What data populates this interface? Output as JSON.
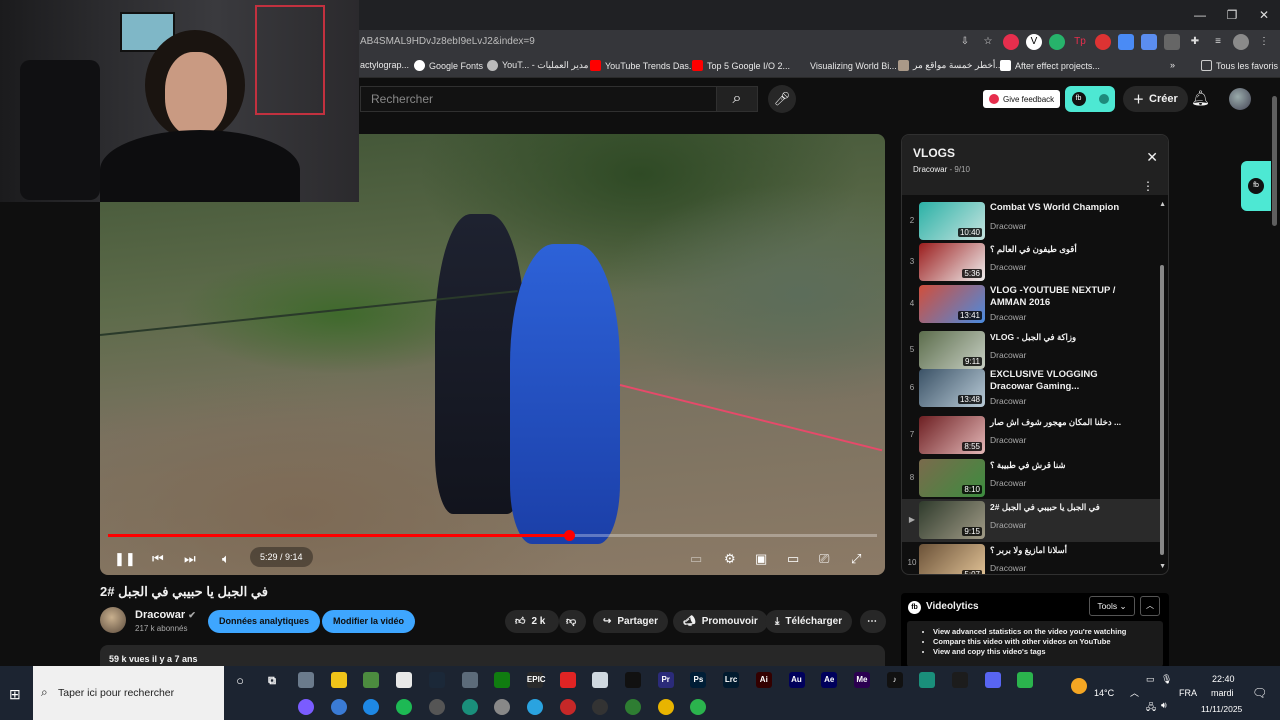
{
  "browser": {
    "url": "AB4SMAL9HDvJz8ebI9eLvJ2&index=9",
    "bookmarks": [
      "actylograp...",
      "Google Fonts",
      "YouT... - مدير العمليات",
      "YouTube Trends Das...",
      "Top 5 Google I/O 2...",
      "Visualizing World Bi...",
      "أخطر خمسة مواقع مر...",
      "After effect projects...",
      "»",
      "Tous les favoris"
    ]
  },
  "header": {
    "search_placeholder": "Rechercher",
    "feedback_label": "Give feedback",
    "create_label": "Créer"
  },
  "player": {
    "time": "5:29 / 9:14",
    "progress": 0.6
  },
  "video": {
    "title": "في الجبل يا حبيبي في الجبل #2",
    "channel": "Dracowar",
    "subscribers": "217 k abonnés",
    "analytics_button": "Données analytiques",
    "edit_button": "Modifier la vidéo",
    "likes": "2 k",
    "share": "Partager",
    "promote": "Promouvoir",
    "download": "Télécharger",
    "more": "⋯",
    "stats": "59 k vues  il y a 7 ans"
  },
  "playlist": {
    "title": "VLOGS",
    "owner": "Dracowar",
    "position": " - 9/10",
    "items": [
      {
        "index": "2",
        "title": "Combat VS World Champion",
        "duration": "10:40",
        "channel": "Dracowar"
      },
      {
        "index": "3",
        "title": "أقوى طيفون في العالم ؟",
        "duration": "5:36",
        "channel": "Dracowar"
      },
      {
        "index": "4",
        "title": "VLOG -YOUTUBE NEXTUP / AMMAN 2016",
        "duration": "13:41",
        "channel": "Dracowar"
      },
      {
        "index": "5",
        "title": "VLOG - وزاكة في الجبل",
        "duration": "9:11",
        "channel": "Dracowar"
      },
      {
        "index": "6",
        "title": "EXCLUSIVE VLOGGING Dracowar Gaming...",
        "duration": "13:48",
        "channel": "Dracowar"
      },
      {
        "index": "7",
        "title": "دخلنا المكان مهجور شوف اش صار ...",
        "duration": "8:55",
        "channel": "Dracowar"
      },
      {
        "index": "8",
        "title": "شنا قرش في طبيبة ؟",
        "duration": "8:10",
        "channel": "Dracowar"
      },
      {
        "index": "▶",
        "title": "في الجبل يا حبيبي في الجبل #2",
        "duration": "9:15",
        "channel": "Dracowar"
      },
      {
        "index": "10",
        "title": "أسلانا امازيغ ولا بربر ؟",
        "duration": "5:07",
        "channel": "Dracowar"
      }
    ]
  },
  "videolytics": {
    "name": "Videolytics",
    "tools": "Tools ⌄",
    "features": [
      "View advanced statistics on the video you're watching",
      "Compare this video with other videos on YouTube",
      "View and copy this video's tags"
    ]
  },
  "taskbar": {
    "search_placeholder": "Taper ici pour rechercher",
    "weather": "14°C",
    "lang": "FRA",
    "time": "22:40",
    "day": "mardi",
    "date": "11/11/2025"
  }
}
